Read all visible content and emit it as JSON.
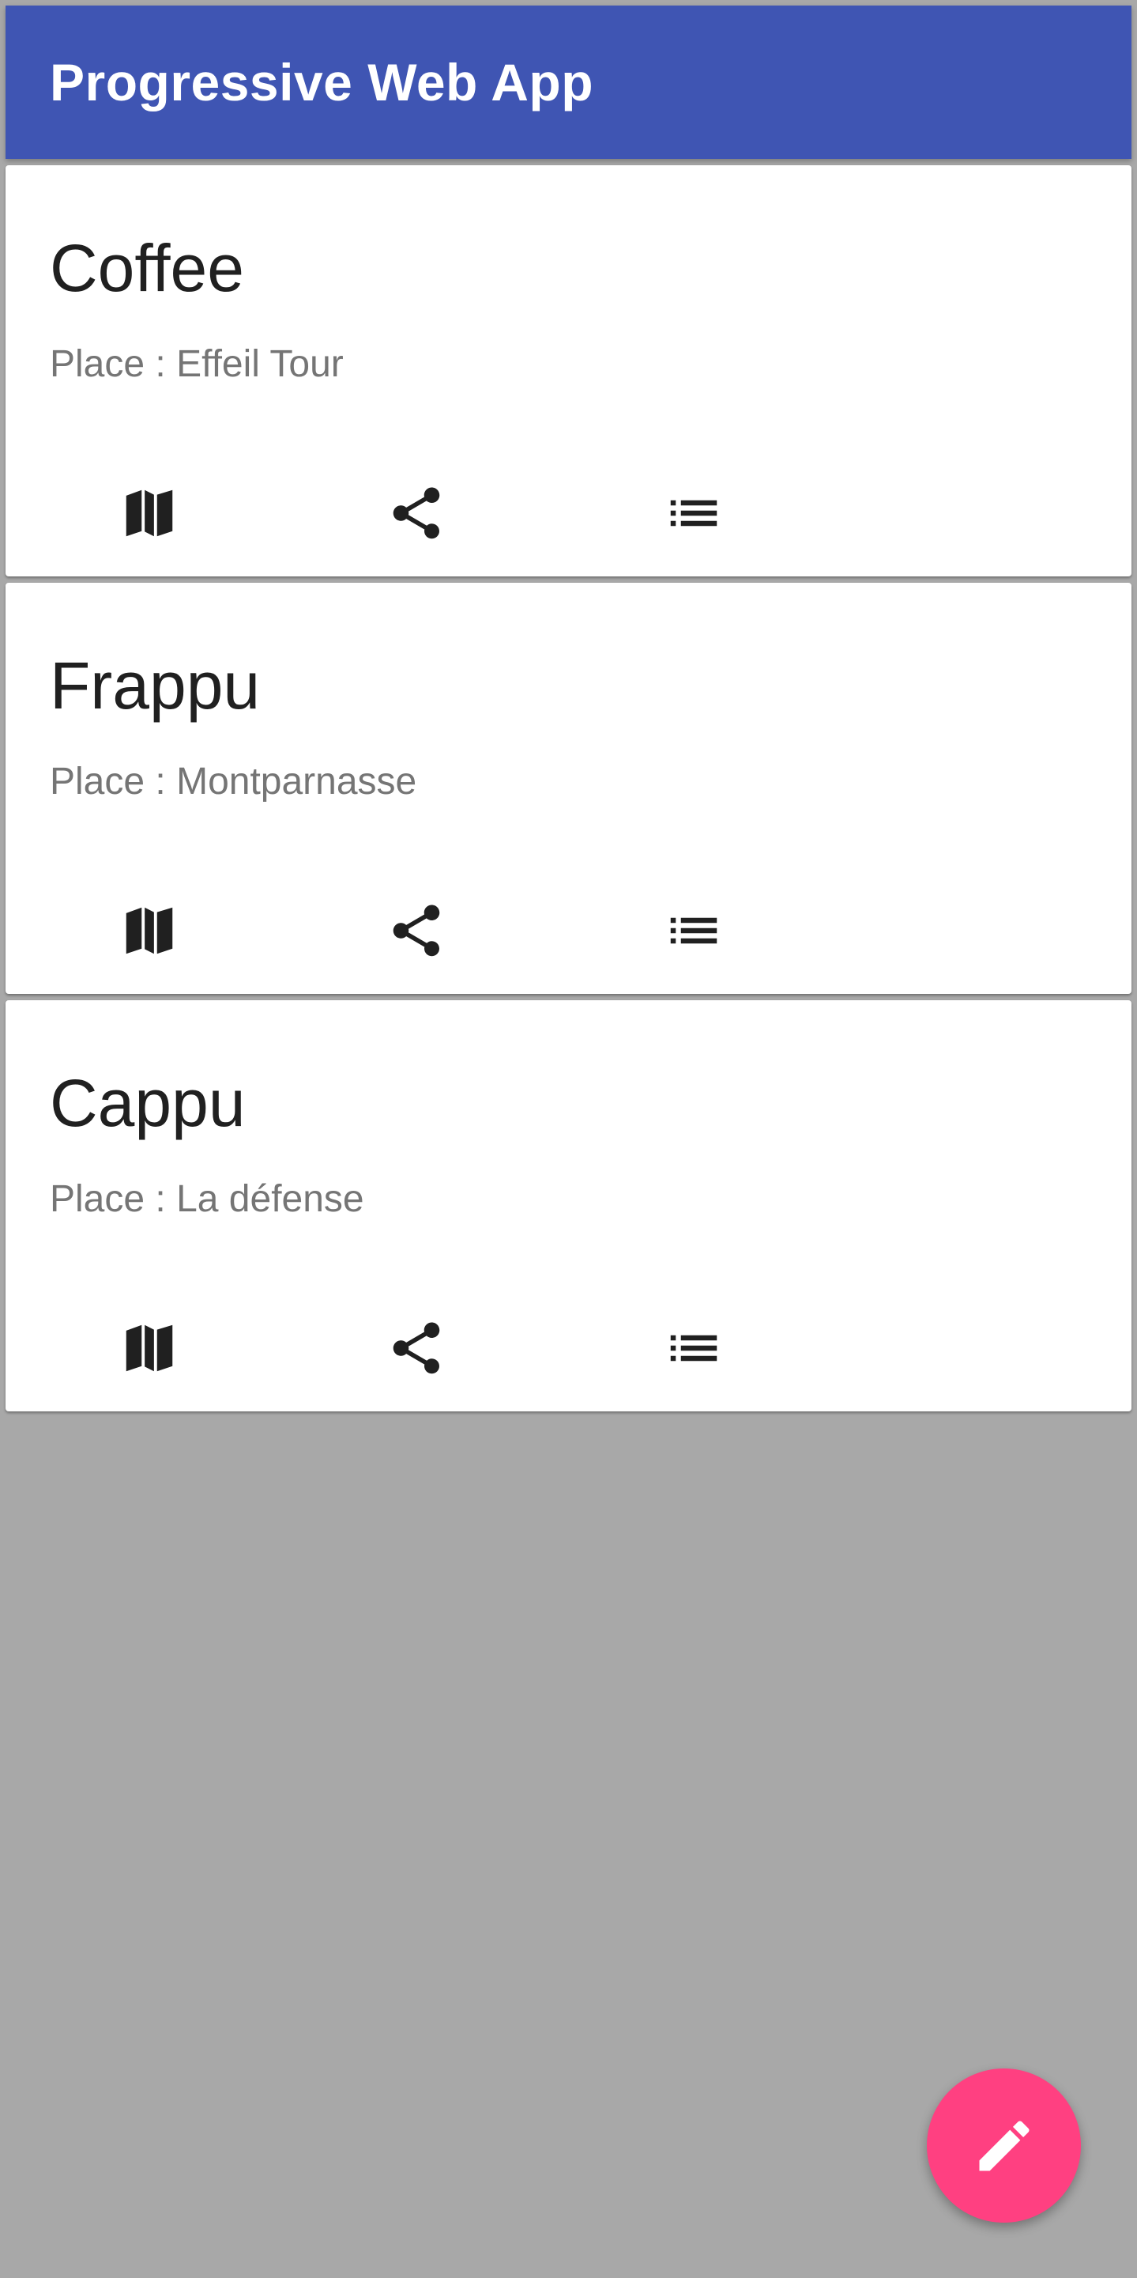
{
  "app_bar": {
    "title": "Progressive Web App",
    "color": "#3f55b3"
  },
  "cards": [
    {
      "title": "Coffee",
      "subtitle": "Place : Effeil Tour",
      "actions": [
        "map-icon",
        "share-icon",
        "list-icon"
      ]
    },
    {
      "title": "Frappu",
      "subtitle": "Place : Montparnasse",
      "actions": [
        "map-icon",
        "share-icon",
        "list-icon"
      ]
    },
    {
      "title": "Cappu",
      "subtitle": "Place : La défense",
      "actions": [
        "map-icon",
        "share-icon",
        "list-icon"
      ]
    }
  ],
  "fab": {
    "icon": "edit-pencil-icon",
    "color": "#ff4081"
  },
  "background_color": "#a8a8a8"
}
